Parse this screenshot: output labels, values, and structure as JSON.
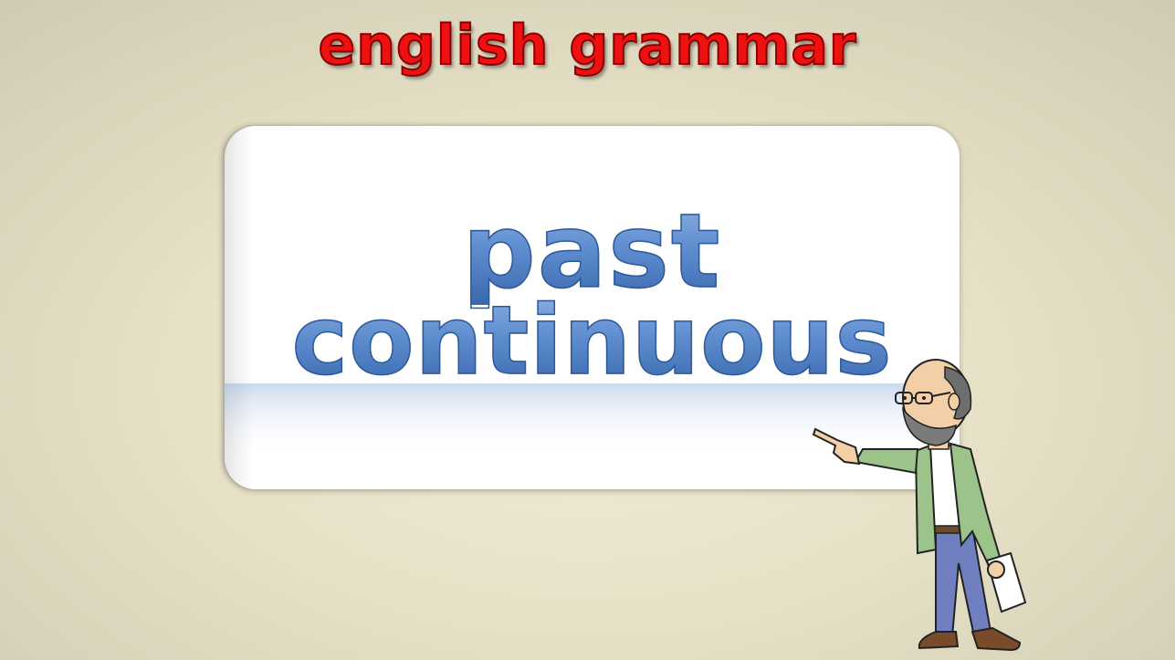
{
  "slide": {
    "heading": "english grammar",
    "card": {
      "title_line_1": "past",
      "title_line_2": "continuous"
    }
  },
  "colors": {
    "heading": "#ee1111",
    "title": "#4a7bc0",
    "background": "#ece6cf"
  },
  "icons": {
    "illustration": "teacher-pointing-icon"
  }
}
